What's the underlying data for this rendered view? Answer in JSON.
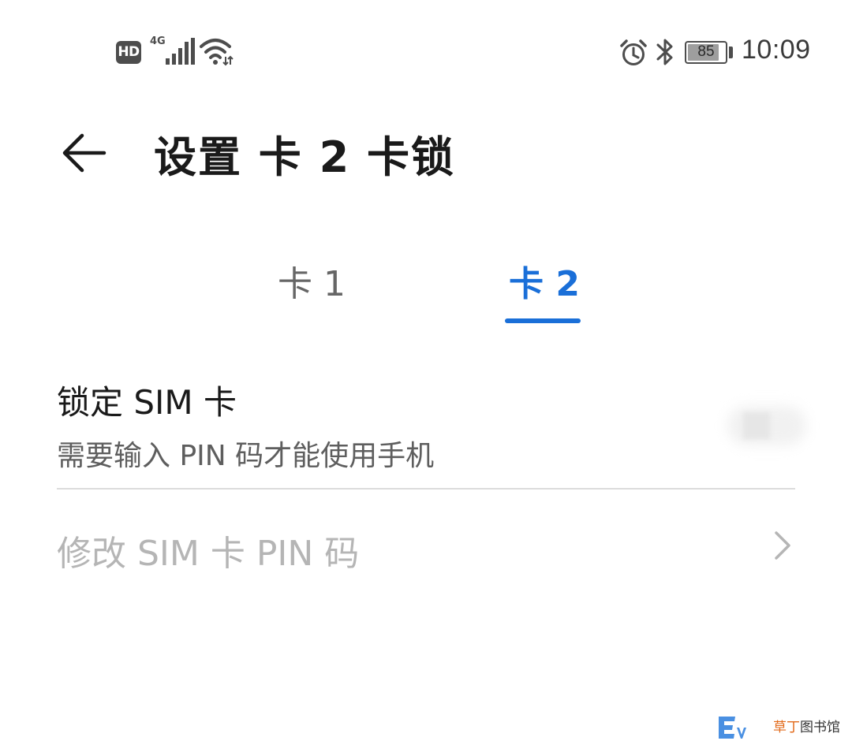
{
  "status_bar": {
    "hd_badge": "HD",
    "network_type": "4G",
    "signal_icon": "cellular-signal-icon",
    "wifi_icon": "wifi-icon",
    "alarm_icon": "alarm-clock-icon",
    "bluetooth_icon": "bluetooth-icon",
    "battery_level": "85",
    "battery_fraction": 0.85,
    "time": "10:09"
  },
  "header": {
    "back_icon": "arrow-left-icon",
    "title": "设置 卡 2 卡锁"
  },
  "tabs": [
    {
      "label": "卡 1",
      "selected": false
    },
    {
      "label": "卡 2",
      "selected": true
    }
  ],
  "settings": {
    "lock_sim": {
      "title": "锁定 SIM 卡",
      "subtitle": "需要输入 PIN 码才能使用手机",
      "switch_state": "obscured"
    },
    "change_pin": {
      "label": "修改 SIM 卡 PIN 码",
      "enabled": false,
      "chevron_icon": "chevron-right-icon"
    }
  },
  "watermark": {
    "accent_text": "草丁",
    "text": "图书馆"
  },
  "colors": {
    "accent": "#1a6fd8",
    "disabled_text": "#b5b5b5",
    "secondary_text": "#5e5e5e",
    "background": "#ffffff"
  }
}
